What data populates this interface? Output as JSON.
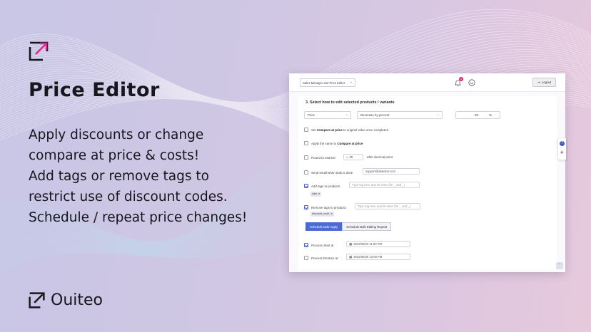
{
  "hero": {
    "title": "Price Editor",
    "lines": [
      "Apply discounts or change",
      "compare at price & costs!",
      "Add tags or remove tags to",
      "restrict use of discount codes.",
      "Schedule / repeat price changes!"
    ]
  },
  "brand": {
    "name": "Ouiteo",
    "accent": "#e0288a"
  },
  "app": {
    "topbar": {
      "app_selector": "Sales Manager and Price Editor",
      "notification_count": "1",
      "logout_label": "Logout"
    },
    "section_title": "3. Select how to edit selected products / variants",
    "field_select": "Price",
    "method_select": "Decrease by percent",
    "amount_value": "20",
    "amount_unit": "%",
    "options": {
      "compare_pre": "Set",
      "compare_bold": "Compare at price",
      "compare_post": "to original value once completed",
      "apply_same_pre": "Apply the same to",
      "apply_same_bold": "Compare at price",
      "round_label": "Round to nearest",
      "round_value": ".99",
      "round_suffix": "after decimal point",
      "email_label": "Send email when task is done",
      "email_value": "support@ablestar.com",
      "add_tags_label": "Add tags to products",
      "add_tags_placeholder": "Type tag here and hit enter (for _ and _)",
      "add_tag_chip": "sale",
      "remove_tags_label": "Remove tags to products",
      "remove_tags_placeholder": "Type tag here and hit enter (for _ and _)",
      "remove_tag_chip": "discount_code"
    },
    "tabs": [
      "Schedule Bulk Apply",
      "Schedule Bulk Editing Repeat"
    ],
    "schedule": {
      "start_label": "Process Start at",
      "start_value": "2022/06/23 11:00 PM",
      "restore_label": "Process Restore at",
      "restore_value": "2022/06/30 12:00 PM"
    }
  }
}
